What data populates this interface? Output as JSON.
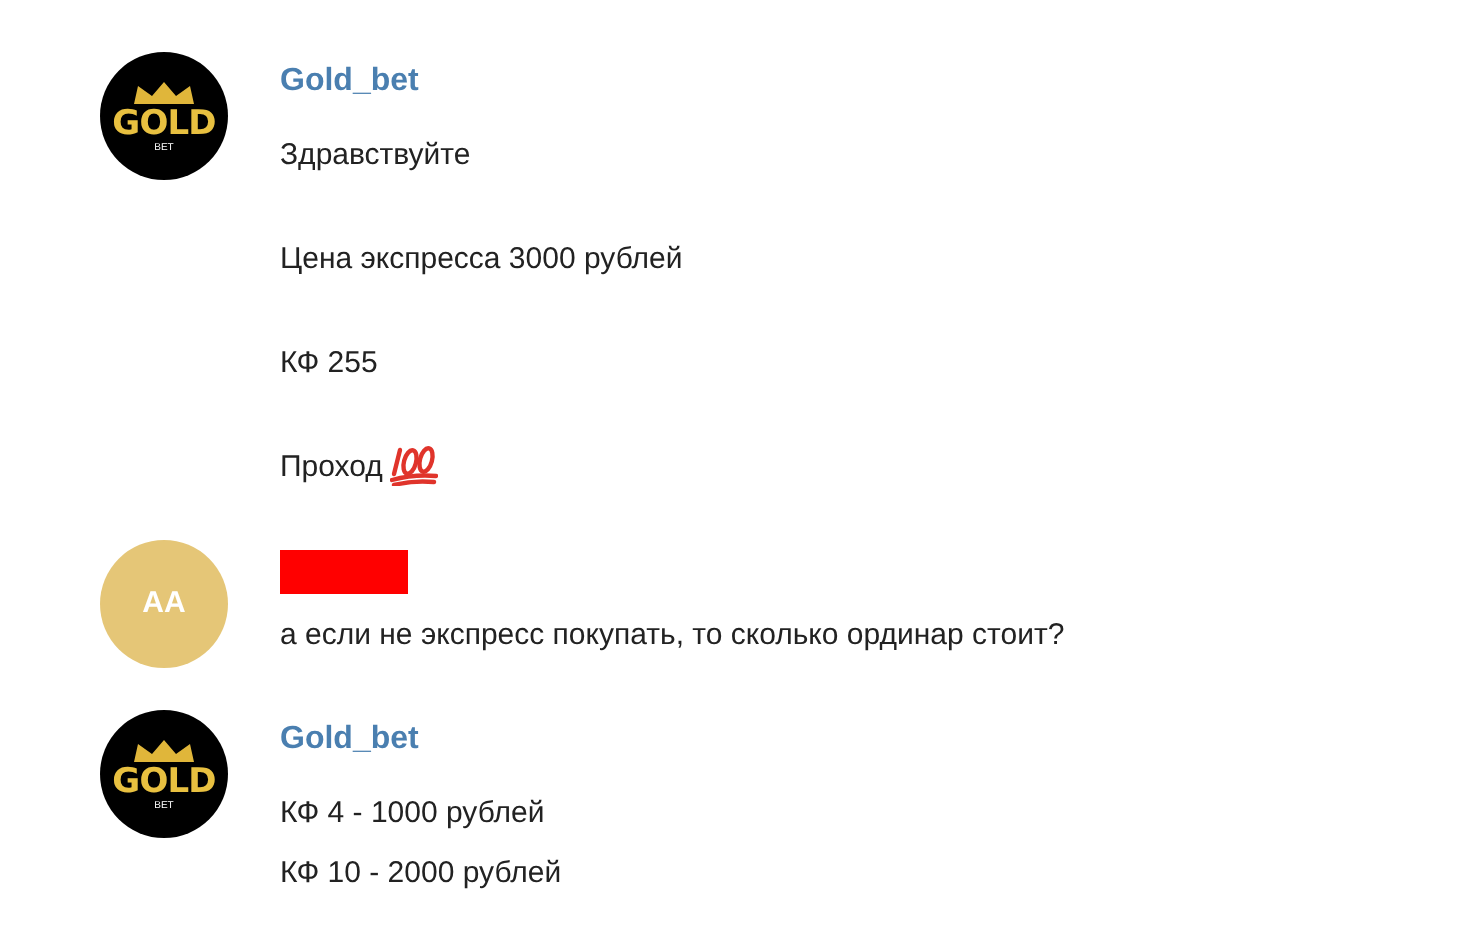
{
  "messages": [
    {
      "avatar": {
        "kind": "logo",
        "logo_text": "GOLD",
        "logo_subtext": "BET"
      },
      "sender": {
        "name": "Gold_bet",
        "redacted": false
      },
      "paragraphs": [
        {
          "lines": [
            "Здравствуйте"
          ]
        },
        {
          "lines": [
            "Цена экспресса 3000 рублей"
          ]
        },
        {
          "lines": [
            "КФ 255"
          ]
        },
        {
          "lines": [
            "Проход"
          ],
          "hundred_emoji": true
        }
      ]
    },
    {
      "avatar": {
        "kind": "initials",
        "initials": "AA",
        "color": "#e5c677"
      },
      "sender": {
        "redacted": true
      },
      "paragraphs": [
        {
          "lines": [
            "а если не экспресс покупать, то сколько ординар стоит?"
          ]
        }
      ]
    },
    {
      "avatar": {
        "kind": "logo",
        "logo_text": "GOLD",
        "logo_subtext": "BET"
      },
      "sender": {
        "name": "Gold_bet",
        "redacted": false
      },
      "paragraphs": [
        {
          "lines": [
            "КФ 4 - 1000 рублей",
            "КФ 10 - 2000 рублей"
          ]
        }
      ]
    }
  ]
}
